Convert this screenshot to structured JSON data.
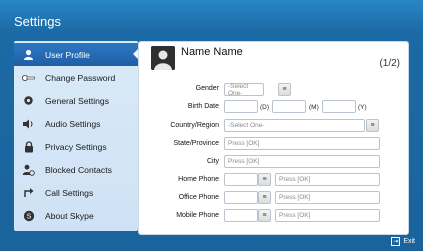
{
  "window": {
    "title": "Settings"
  },
  "sidebar": {
    "items": [
      {
        "label": "User Profile",
        "icon": "user-icon",
        "active": true
      },
      {
        "label": "Change Password",
        "icon": "key-icon",
        "active": false
      },
      {
        "label": "General Settings",
        "icon": "gear-icon",
        "active": false
      },
      {
        "label": "Audio Settings",
        "icon": "speaker-icon",
        "active": false
      },
      {
        "label": "Privacy Settings",
        "icon": "lock-icon",
        "active": false
      },
      {
        "label": "Blocked Contacts",
        "icon": "blocked-user-icon",
        "active": false
      },
      {
        "label": "Call Settings",
        "icon": "call-forward-icon",
        "active": false
      },
      {
        "label": "About Skype",
        "icon": "skype-icon",
        "active": false
      }
    ]
  },
  "profile": {
    "name": "Name Name",
    "page": "(1/2)",
    "fields": {
      "gender": {
        "label": "Gender",
        "placeholder": "-Select One-"
      },
      "birth_date": {
        "label": "Birth Date",
        "day_unit": "(D)",
        "month_unit": "(M)",
        "year_unit": "(Y)"
      },
      "country": {
        "label": "Country/Region",
        "placeholder": "-Select One-"
      },
      "state": {
        "label": "State/Province",
        "placeholder": "Press [OK]"
      },
      "city": {
        "label": "City",
        "placeholder": "Press [OK]"
      },
      "home_phone": {
        "label": "Home Phone",
        "placeholder": "Press [OK]"
      },
      "office_phone": {
        "label": "Office Phone",
        "placeholder": "Press [OK]"
      },
      "mobile_phone": {
        "label": "Mobile Phone",
        "placeholder": "Press [OK]"
      }
    }
  },
  "footer": {
    "exit_label": "Exit"
  }
}
